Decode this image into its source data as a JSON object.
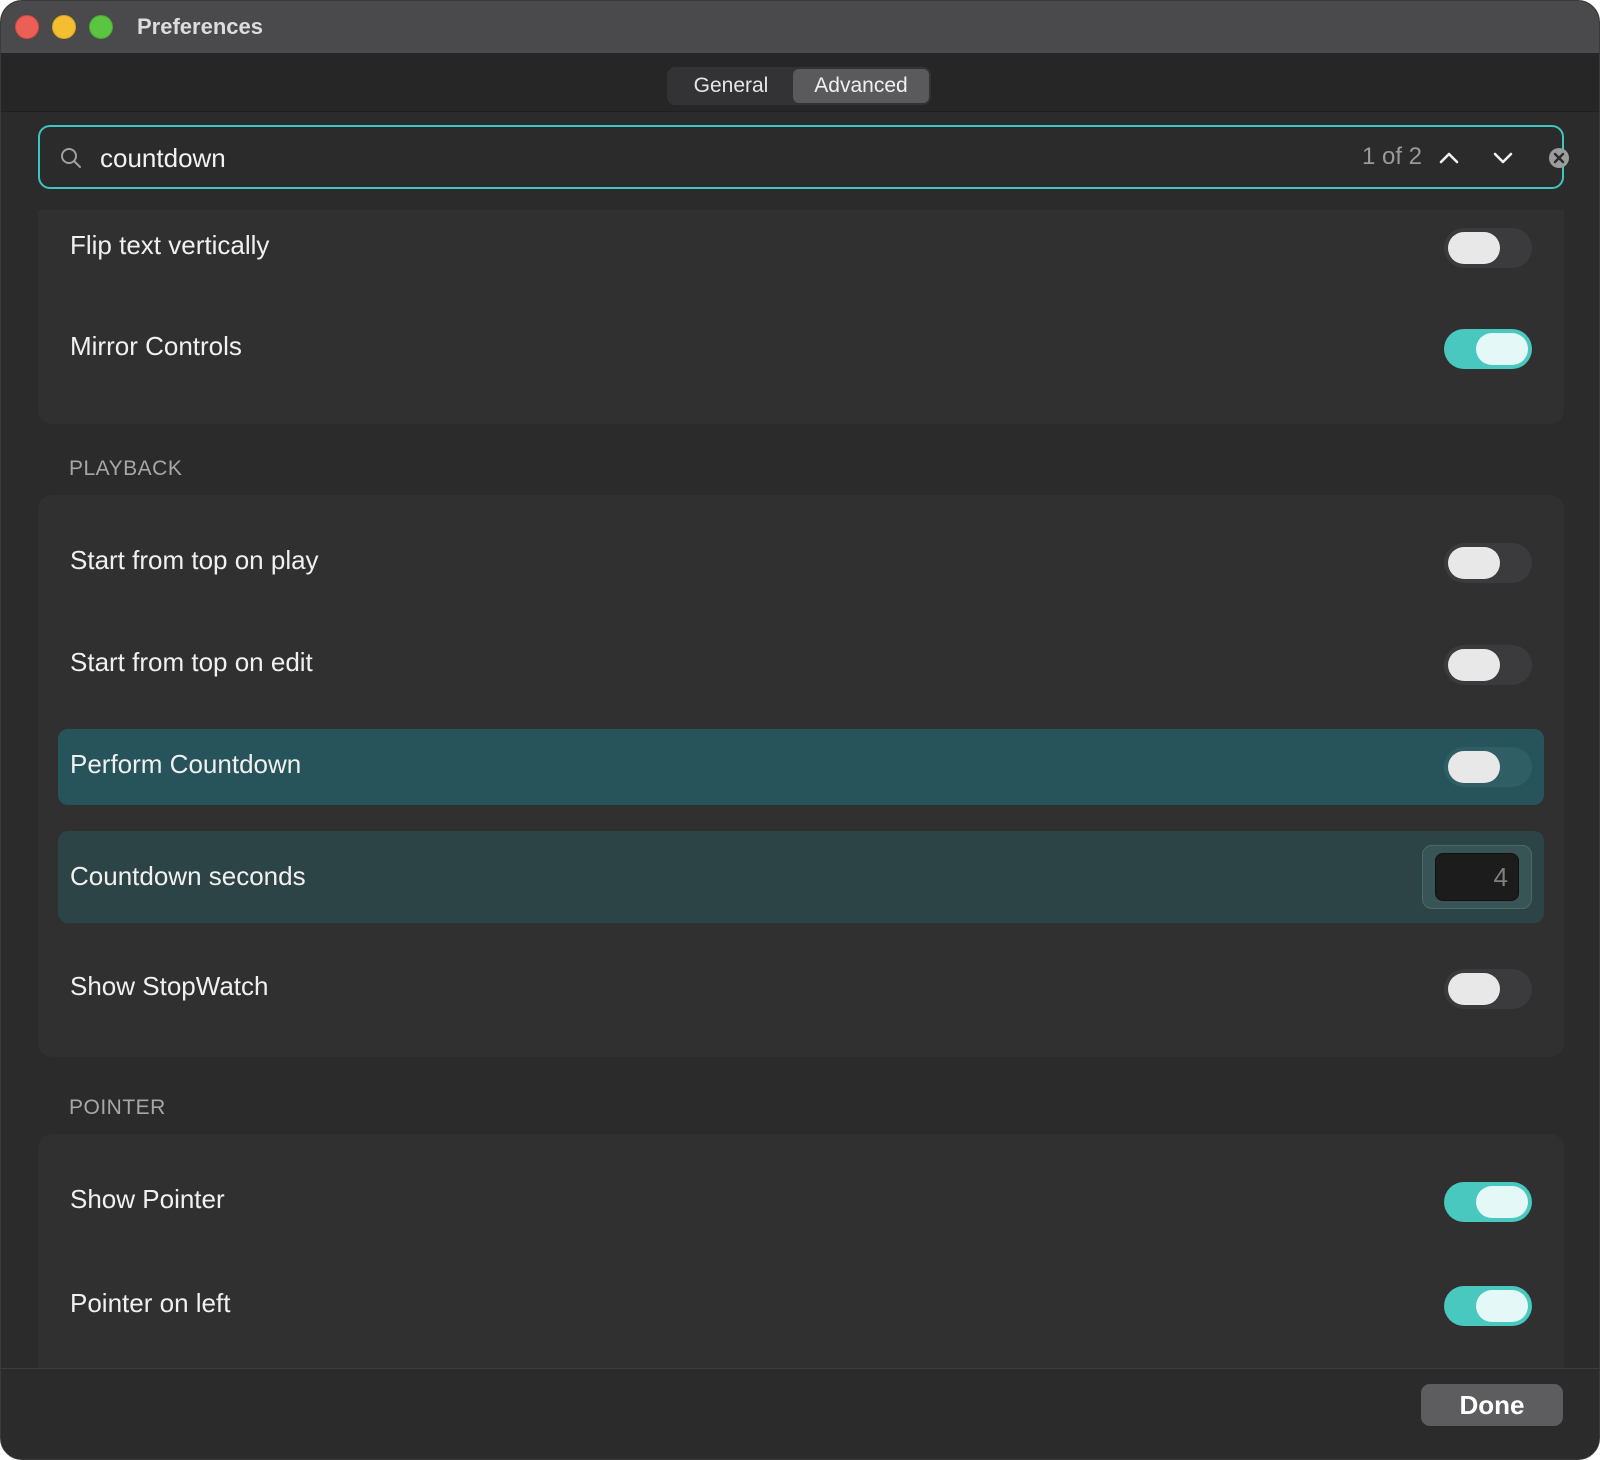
{
  "window": {
    "title": "Preferences"
  },
  "tabs": [
    {
      "label": "General",
      "active": false
    },
    {
      "label": "Advanced",
      "active": true
    }
  ],
  "search": {
    "value": "countdown",
    "placeholder": "",
    "match_count": "1 of 2"
  },
  "display_group": {
    "items": [
      {
        "label": "Flip text vertically",
        "toggle": "off"
      },
      {
        "label": "Mirror Controls",
        "toggle": "on"
      }
    ]
  },
  "playback": {
    "header": "PLAYBACK",
    "items": [
      {
        "label": "Start from top on play",
        "toggle": "off"
      },
      {
        "label": "Start from top on edit",
        "toggle": "off"
      },
      {
        "label": "Perform Countdown",
        "toggle": "off",
        "highlighted": true
      },
      {
        "label": "Countdown seconds",
        "value": "4",
        "highlighted": true
      },
      {
        "label": "Show StopWatch",
        "toggle": "off"
      }
    ]
  },
  "pointer": {
    "header": "POINTER",
    "items": [
      {
        "label": "Show Pointer",
        "toggle": "on"
      },
      {
        "label": "Pointer on left",
        "toggle": "on"
      }
    ]
  },
  "footer": {
    "done_label": "Done"
  },
  "colors": {
    "accent": "#48c8bf",
    "highlight_row": "#27535a",
    "background": "#2b2b2b"
  }
}
